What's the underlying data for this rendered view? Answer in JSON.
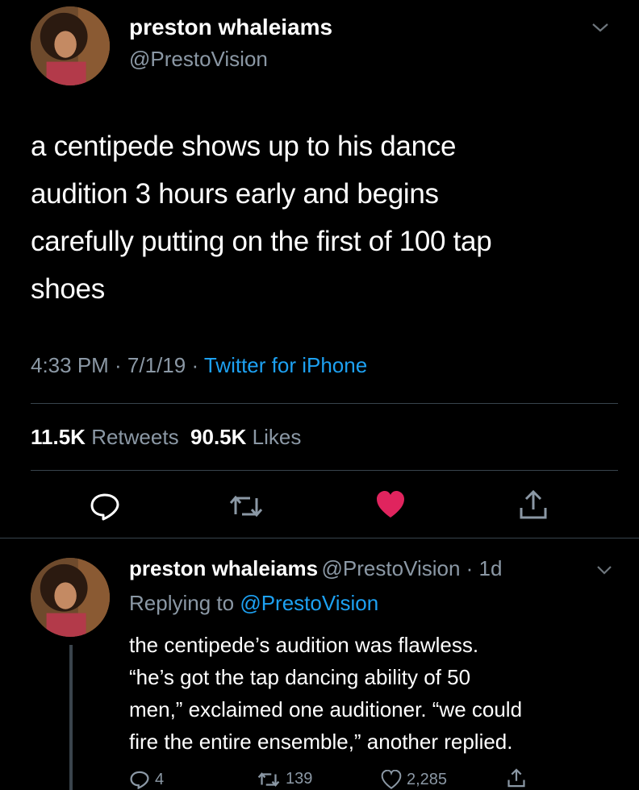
{
  "main_tweet": {
    "author_name": "preston whaleiams",
    "author_handle": "@PrestoVision",
    "text_lines": [
      "a centipede shows up to his dance",
      "audition 3 hours early and begins",
      "carefully putting on the first of 100 tap",
      "shoes"
    ],
    "timestamp": "4:33 PM · 7/1/19 · ",
    "source": "Twitter for iPhone",
    "retweets_count": "11.5K",
    "retweets_label": "Retweets",
    "likes_count": "90.5K",
    "likes_label": "Likes",
    "icons": [
      "reply-icon",
      "retweet-icon",
      "heart-icon",
      "share-icon"
    ],
    "liked_color": "#e0245e"
  },
  "reply_tweet": {
    "author_name": "preston whaleiams",
    "author_handle": "@PrestoVision · 1d",
    "replying_prefix": "Replying to ",
    "replying_to": "@PrestoVision",
    "text_lines": [
      "the centipede’s audition was flawless.",
      "“he’s got the tap dancing ability of 50",
      "men,” exclaimed one auditioner. “we could",
      "fire the entire ensemble,” another replied."
    ],
    "reply_count": "4",
    "retweet_count": "139",
    "like_count": "2,285"
  },
  "colors": {
    "background": "#000000",
    "secondary_text": "#8b98a5",
    "link": "#1da1f2",
    "divider": "#38444d"
  }
}
